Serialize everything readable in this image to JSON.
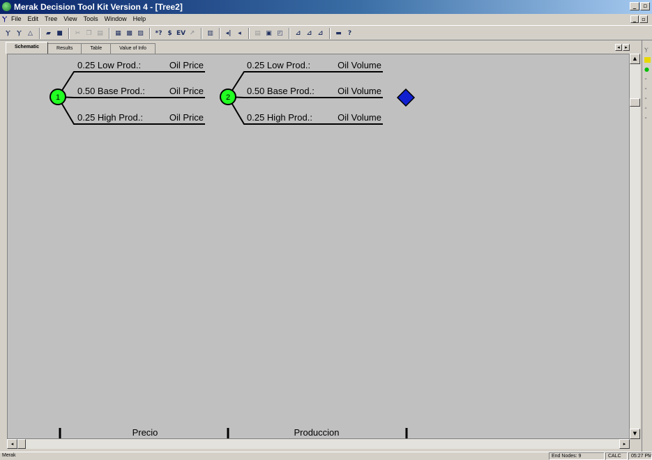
{
  "window": {
    "title": "Merak Decision Tool Kit Version 4 - [Tree2]",
    "min_glyph": "_",
    "restore_glyph": "▫",
    "close_glyph": "x"
  },
  "menu": {
    "items": [
      "File",
      "Edit",
      "Tree",
      "View",
      "Tools",
      "Window",
      "Help"
    ]
  },
  "toolbar": {
    "groups": [
      [
        {
          "name": "decision-node-icon",
          "glyph": "Ⲩ"
        },
        {
          "name": "chance-node-icon",
          "glyph": "Ⲩ"
        },
        {
          "name": "terminal-node-icon",
          "glyph": "△"
        }
      ],
      [
        {
          "name": "open-icon",
          "glyph": "▰"
        },
        {
          "name": "save-icon",
          "glyph": "■"
        }
      ],
      [
        {
          "name": "cut-icon",
          "glyph": "✂",
          "dim": true
        },
        {
          "name": "copy-icon",
          "glyph": "❐",
          "dim": true
        },
        {
          "name": "paste-icon",
          "glyph": "▤",
          "dim": true
        }
      ],
      [
        {
          "name": "grid-icon",
          "glyph": "▦"
        },
        {
          "name": "table-icon",
          "glyph": "▩"
        },
        {
          "name": "chart-icon",
          "glyph": "▨"
        }
      ],
      [
        {
          "name": "probability-icon",
          "glyph": "*?"
        },
        {
          "name": "value-icon",
          "glyph": "$"
        },
        {
          "name": "ev-icon",
          "glyph": "EV"
        },
        {
          "name": "sensitivity-icon",
          "glyph": "↗",
          "dim": true
        }
      ],
      [
        {
          "name": "report-icon",
          "glyph": "▥"
        }
      ],
      [
        {
          "name": "rollback-icon",
          "glyph": "◂|"
        },
        {
          "name": "undo-icon",
          "glyph": "◂"
        }
      ],
      [
        {
          "name": "document-icon",
          "glyph": "▤",
          "dim": true
        },
        {
          "name": "print-preview-icon",
          "glyph": "▣"
        },
        {
          "name": "zoom-icon",
          "glyph": "◰"
        }
      ],
      [
        {
          "name": "tree-view-icon",
          "glyph": "⊿"
        },
        {
          "name": "tree-expand-icon",
          "glyph": "⊿"
        },
        {
          "name": "tree-collapse-icon",
          "glyph": "⊿"
        }
      ],
      [
        {
          "name": "print-icon",
          "glyph": "▬"
        },
        {
          "name": "help-icon",
          "glyph": "?"
        }
      ]
    ]
  },
  "tabs": [
    {
      "label": "Schematic",
      "active": true
    },
    {
      "label": "Results",
      "active": false
    },
    {
      "label": "Table",
      "active": false
    },
    {
      "label": "Value of Info",
      "active": false
    }
  ],
  "tree": {
    "node_colors": {
      "chance": "#22ff22",
      "terminal": "#1020d0"
    },
    "nodes": [
      {
        "number": "1",
        "branches": [
          {
            "probability": "0.25",
            "state": "Low Prod.:",
            "variable": "Oil Price"
          },
          {
            "probability": "0.50",
            "state": "Base Prod.:",
            "variable": "Oil Price"
          },
          {
            "probability": "0.25",
            "state": "High Prod.:",
            "variable": "Oil Price"
          }
        ]
      },
      {
        "number": "2",
        "branches": [
          {
            "probability": "0.25",
            "state": "Low Prod.:",
            "variable": "Oil Volume"
          },
          {
            "probability": "0.50",
            "state": "Base Prod.:",
            "variable": "Oil Volume"
          },
          {
            "probability": "0.25",
            "state": "High Prod.:",
            "variable": "Oil Volume"
          }
        ]
      }
    ],
    "stage_labels": [
      "Precio",
      "Produccion"
    ]
  },
  "statusbar": {
    "left": "Merak",
    "end_nodes": "End Nodes: 9",
    "mode": "CALC",
    "time": "05:27 PM"
  }
}
